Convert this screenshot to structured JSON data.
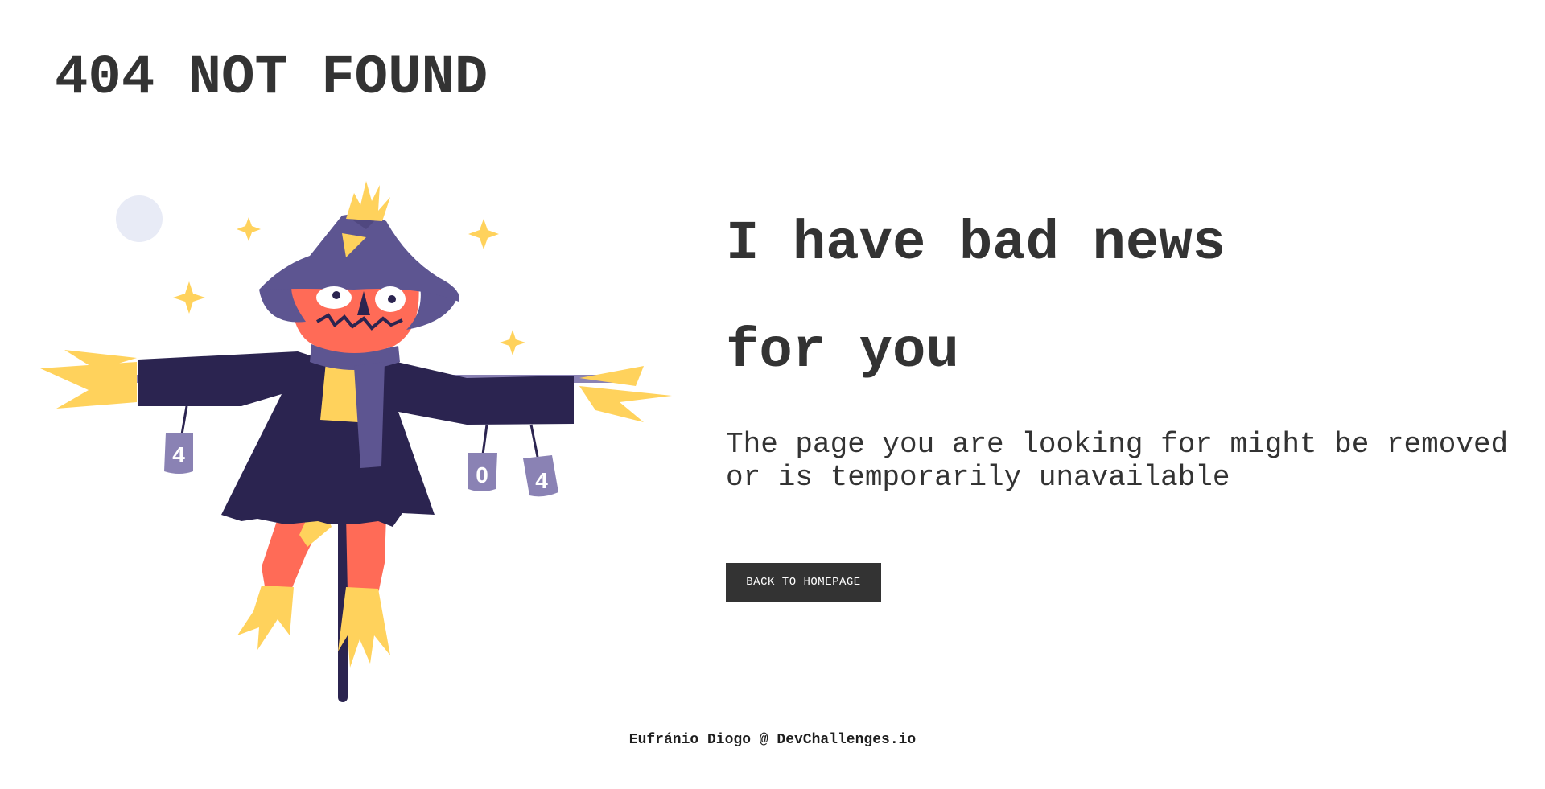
{
  "page_title": "404 NOT FOUND",
  "headline": {
    "line1": "I have bad news",
    "line2": "for you"
  },
  "message": {
    "line1": "The page you are looking for might be removed",
    "line2": "or is temporarily unavailable"
  },
  "cta": {
    "label": "BACK TO HOMEPAGE"
  },
  "footer": {
    "credit": "Eufránio Diogo @ DevChallenges.io"
  },
  "illustration": {
    "subject": "scarecrow-icon",
    "cans": [
      "4",
      "0",
      "4"
    ],
    "colors": {
      "coat": "#2b2450",
      "hat": "#5d5591",
      "face": "#ff6b57",
      "straw": "#ffd25c",
      "can": "#8a82b4",
      "moon": "#e8ebf6"
    }
  },
  "colors": {
    "text": "#333333",
    "button_bg": "#333333",
    "button_text": "#ffffff",
    "background": "#ffffff"
  }
}
